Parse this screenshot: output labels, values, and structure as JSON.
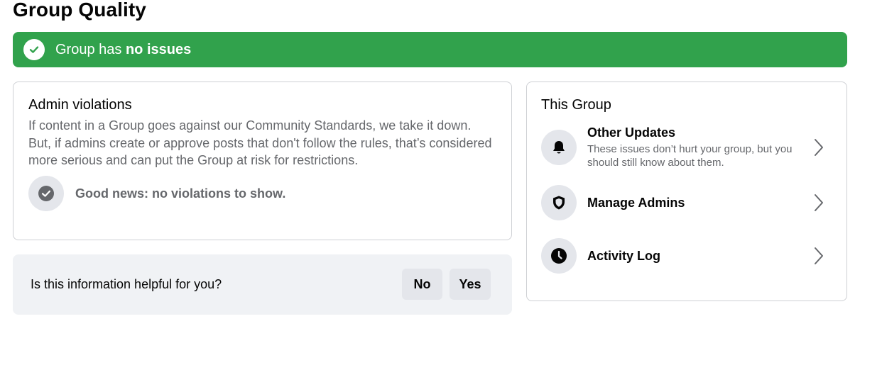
{
  "page": {
    "title": "Group Quality"
  },
  "status_banner": {
    "prefix": "Group has ",
    "emphasis": "no issues",
    "color": "#31a24c",
    "icon": "check-circle-icon"
  },
  "admin_violations": {
    "title": "Admin violations",
    "description": "If content in a Group goes against our Community Standards, we take it down. But, if admins create or approve posts that don't follow the rules, that’s considered more serious and can put the Group at risk for restrictions.",
    "good_news": "Good news: no violations to show.",
    "good_news_icon": "check-circle-icon"
  },
  "feedback": {
    "question": "Is this information helpful for you?",
    "no_label": "No",
    "yes_label": "Yes"
  },
  "this_group": {
    "title": "This Group",
    "items": [
      {
        "icon": "bell-icon",
        "title": "Other Updates",
        "subtitle": "These issues don’t hurt your group, but you should still know about them."
      },
      {
        "icon": "shield-icon",
        "title": "Manage Admins"
      },
      {
        "icon": "clock-icon",
        "title": "Activity Log"
      }
    ]
  }
}
